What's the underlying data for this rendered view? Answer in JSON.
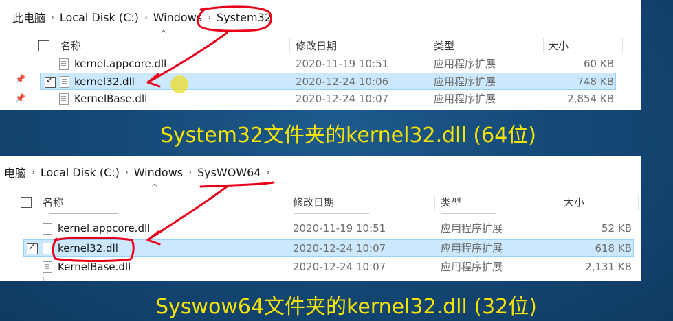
{
  "panel1": {
    "breadcrumb": [
      "此电脑",
      "Local Disk (C:)",
      "Windows",
      "System32"
    ],
    "columns": {
      "name": "名称",
      "date": "修改日期",
      "type": "类型",
      "size": "大小"
    },
    "rows": [
      {
        "name": "kernel.appcore.dll",
        "date": "2020-11-19 10:51",
        "type": "应用程序扩展",
        "size": "60 KB",
        "selected": false
      },
      {
        "name": "kernel32.dll",
        "date": "2020-12-24 10:06",
        "type": "应用程序扩展",
        "size": "748 KB",
        "selected": true
      },
      {
        "name": "KernelBase.dll",
        "date": "2020-12-24 10:07",
        "type": "应用程序扩展",
        "size": "2,854 KB",
        "selected": false
      }
    ]
  },
  "panel2": {
    "breadcrumb": [
      "电脑",
      "Local Disk (C:)",
      "Windows",
      "SysWOW64"
    ],
    "columns": {
      "name": "名称",
      "date": "修改日期",
      "type": "类型",
      "size": "大小"
    },
    "rows": [
      {
        "name": "kernel.appcore.dll",
        "date": "2020-11-19 10:51",
        "type": "应用程序扩展",
        "size": "52 KB",
        "selected": false
      },
      {
        "name": "kernel32.dll",
        "date": "2020-12-24 10:07",
        "type": "应用程序扩展",
        "size": "618 KB",
        "selected": true
      },
      {
        "name": "KernelBase.dll",
        "date": "2020-12-24 10:07",
        "type": "应用程序扩展",
        "size": "2,131 KB",
        "selected": false
      }
    ]
  },
  "captions": {
    "top": "System32文件夹的kernel32.dll (64位)",
    "bottom": "Syswow64文件夹的kernel32.dll (32位)"
  },
  "colors": {
    "caption": "#f5e400",
    "annotation": "#e8001a",
    "selection": "#cce8ff",
    "background": "#154a78"
  }
}
